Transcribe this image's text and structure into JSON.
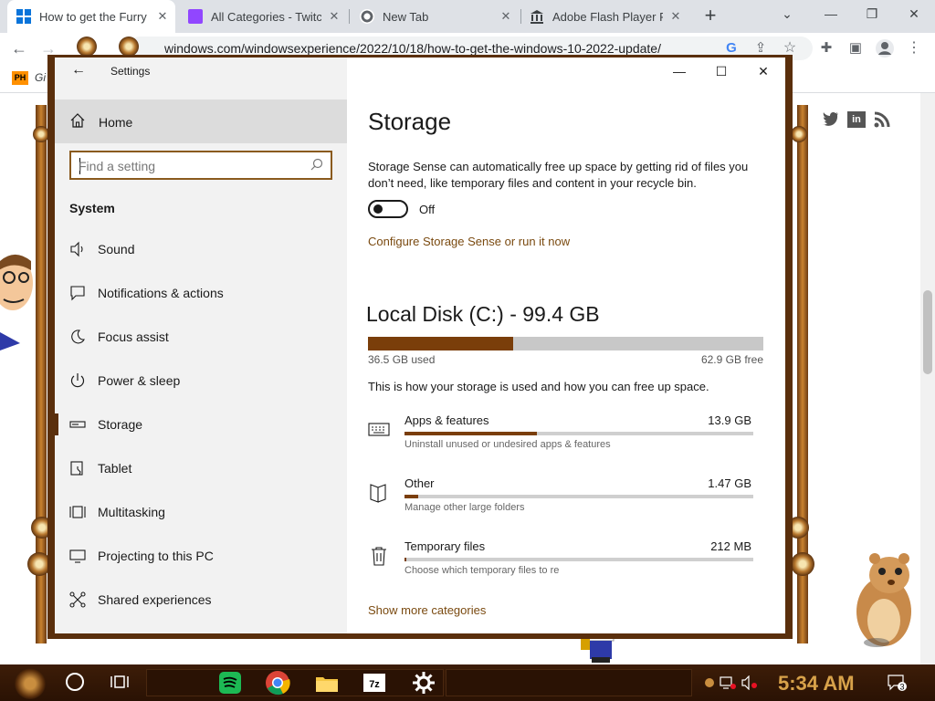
{
  "browser": {
    "tabs": [
      {
        "title": "How to get the Furry",
        "active": true
      },
      {
        "title": "All Categories - Twitc",
        "active": false
      },
      {
        "title": "New Tab",
        "active": false
      },
      {
        "title": "Adobe Flash Player Pr",
        "active": false
      }
    ],
    "url_prefix": "",
    "url": "windows.com/windowsexperience/2022/10/18/how-to-get-the-windows-10-2022-update/",
    "bookmark_icon": "PH",
    "bookmark_label": "Gi"
  },
  "settings": {
    "title": "Settings",
    "home": "Home",
    "search_placeholder": "Find a setting",
    "section": "System",
    "nav": [
      {
        "label": "Sound",
        "icon": "speaker-icon"
      },
      {
        "label": "Notifications & actions",
        "icon": "notification-icon"
      },
      {
        "label": "Focus assist",
        "icon": "moon-icon"
      },
      {
        "label": "Power & sleep",
        "icon": "power-icon"
      },
      {
        "label": "Storage",
        "icon": "storage-icon",
        "selected": true
      },
      {
        "label": "Tablet",
        "icon": "tablet-icon"
      },
      {
        "label": "Multitasking",
        "icon": "multitasking-icon"
      },
      {
        "label": "Projecting to this PC",
        "icon": "projecting-icon"
      },
      {
        "label": "Shared experiences",
        "icon": "shared-icon"
      }
    ],
    "page": {
      "title": "Storage",
      "description": "Storage Sense can automatically free up space by getting rid of files you don’t need, like temporary files and content in your recycle bin.",
      "toggle_state": "Off",
      "configure_link": "Configure Storage Sense or run it now",
      "disk_title": "Local Disk (C:) - 99.4 GB",
      "disk_used": "36.5 GB used",
      "disk_free": "62.9 GB free",
      "disk_used_fraction": 0.367,
      "how_text": "This is how your storage is used and how you can free up space.",
      "categories": [
        {
          "name": "Apps & features",
          "size": "13.9 GB",
          "fraction": 0.38,
          "desc": "Uninstall unused or undesired apps & features",
          "icon": "apps-features-icon"
        },
        {
          "name": "Other",
          "size": "1.47 GB",
          "fraction": 0.04,
          "desc": "Manage other large folders",
          "icon": "folder-icon"
        },
        {
          "name": "Temporary files",
          "size": "212 MB",
          "fraction": 0.006,
          "desc": "Choose which temporary files to re",
          "icon": "trash-icon"
        }
      ],
      "more_link": "Show more categories"
    }
  },
  "taskbar": {
    "clock": "5:34 AM",
    "notification_count": "3"
  },
  "colors": {
    "accent": "#7a3e0a",
    "window_border": "#5a2f0c",
    "link": "#7a4a10"
  }
}
